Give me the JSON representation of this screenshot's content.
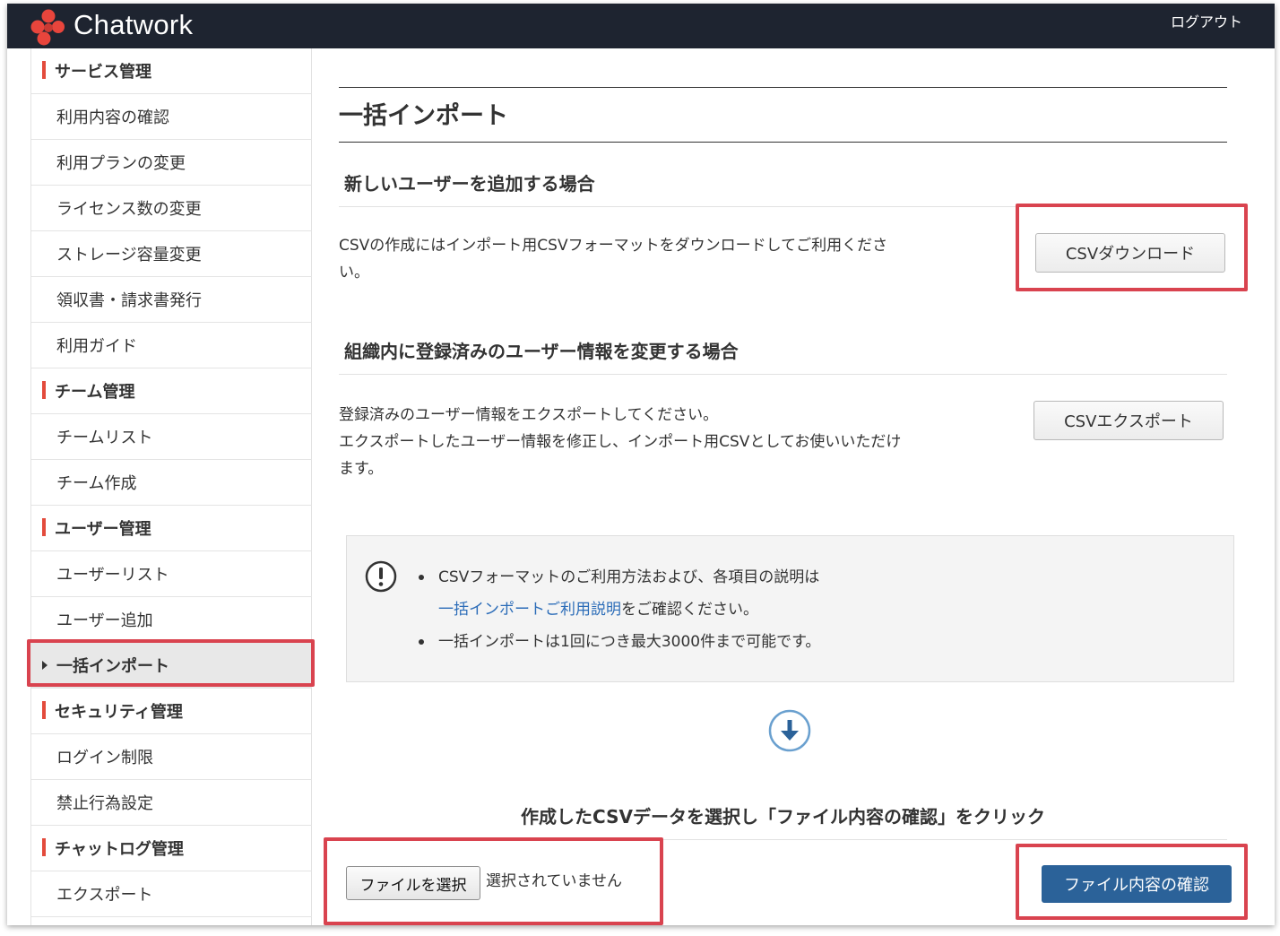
{
  "header": {
    "brand": "Chatwork",
    "logout_label": "ログアウト"
  },
  "sidebar": {
    "items": [
      {
        "type": "group",
        "label": "サービス管理"
      },
      {
        "type": "item",
        "label": "利用内容の確認"
      },
      {
        "type": "item",
        "label": "利用プランの変更"
      },
      {
        "type": "item",
        "label": "ライセンス数の変更"
      },
      {
        "type": "item",
        "label": "ストレージ容量変更"
      },
      {
        "type": "item",
        "label": "領収書・請求書発行"
      },
      {
        "type": "item",
        "label": "利用ガイド"
      },
      {
        "type": "group",
        "label": "チーム管理"
      },
      {
        "type": "item",
        "label": "チームリスト"
      },
      {
        "type": "item",
        "label": "チーム作成"
      },
      {
        "type": "group",
        "label": "ユーザー管理"
      },
      {
        "type": "item",
        "label": "ユーザーリスト"
      },
      {
        "type": "item",
        "label": "ユーザー追加"
      },
      {
        "type": "item",
        "label": "一括インポート",
        "active": true
      },
      {
        "type": "group",
        "label": "セキュリティ管理"
      },
      {
        "type": "item",
        "label": "ログイン制限"
      },
      {
        "type": "item",
        "label": "禁止行為設定"
      },
      {
        "type": "group",
        "label": "チャットログ管理"
      },
      {
        "type": "item",
        "label": "エクスポート"
      }
    ]
  },
  "main": {
    "title": "一括インポート",
    "new_users": {
      "heading": "新しいユーザーを追加する場合",
      "text_line1": "CSVの作成にはインポート用CSVフォーマットをダウンロードしてご利用くださ",
      "text_line2": "い。",
      "button": "CSVダウンロード"
    },
    "existing_users": {
      "heading": "組織内に登録済みのユーザー情報を変更する場合",
      "text_line1": "登録済みのユーザー情報をエクスポートしてください。",
      "text_line2": "エクスポートしたユーザー情報を修正し、インポート用CSVとしてお使いいただけ",
      "text_line3": "ます。",
      "button": "CSVエクスポート"
    },
    "notice": {
      "bullet1_line1": "CSVフォーマットのご利用方法および、各項目の説明は",
      "bullet1_link": "一括インポートご利用説明",
      "bullet1_line2_rest": "をご確認ください。",
      "bullet2": "一括インポートは1回につき最大3000件まで可能です。"
    },
    "select_heading": "作成したCSVデータを選択し「ファイル内容の確認」をクリック",
    "file_input": {
      "button": "ファイルを選択",
      "status": "選択されていません"
    },
    "confirm_button": "ファイル内容の確認"
  },
  "colors": {
    "header_bg": "#1e2430",
    "accent_red": "#e34b3c",
    "highlight_box": "#d9434f",
    "primary_button": "#2b6299",
    "link": "#2b6cb8"
  }
}
